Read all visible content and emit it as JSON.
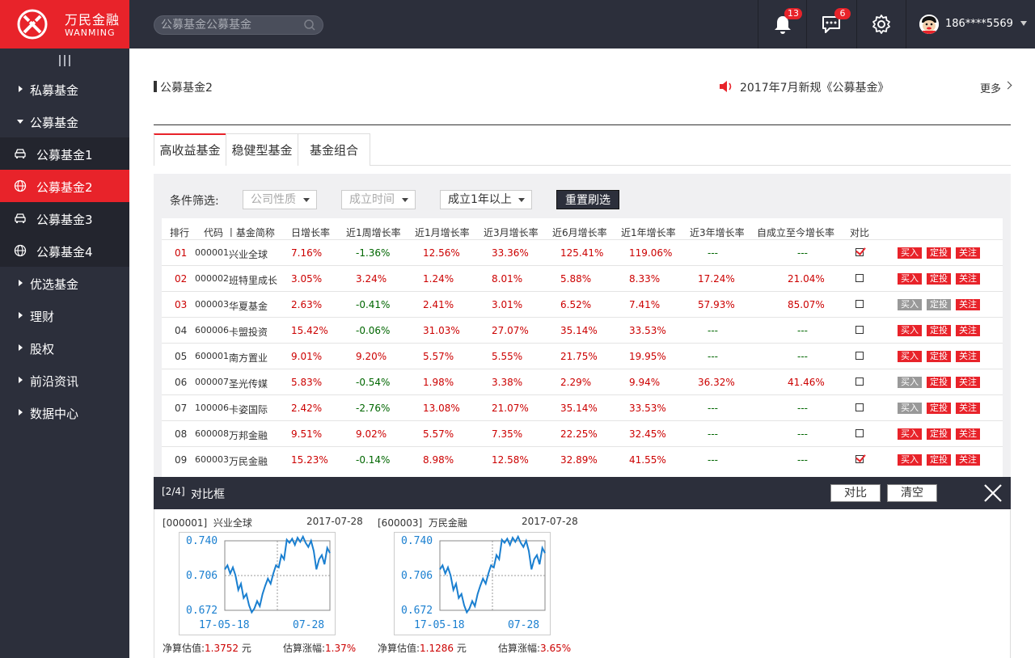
{
  "brand": {
    "name_cn": "万民金融",
    "name_en": "WANMING",
    "accent": "#e8232a",
    "dark": "#2c2f3b"
  },
  "header": {
    "search_placeholder": "公募基金公募基金",
    "notifications": {
      "icon": "bell-icon",
      "count": "13"
    },
    "messages": {
      "icon": "chat-icon",
      "count": "6"
    },
    "settings_icon": "gear-icon",
    "user": {
      "phone": "186****5569"
    }
  },
  "sidebar": {
    "items": [
      {
        "label": "私募基金",
        "expanded": false
      },
      {
        "label": "公募基金",
        "expanded": true
      }
    ],
    "sub_items": [
      {
        "label": "公募基金1",
        "icon": "car-icon",
        "active": false
      },
      {
        "label": "公募基金2",
        "icon": "globe-icon",
        "active": true
      },
      {
        "label": "公募基金3",
        "icon": "car-icon",
        "active": false
      },
      {
        "label": "公募基金4",
        "icon": "globe-icon",
        "active": false
      }
    ],
    "bottom_items": [
      {
        "label": "优选基金"
      },
      {
        "label": "理财"
      },
      {
        "label": "股权"
      },
      {
        "label": "前沿资讯"
      },
      {
        "label": "数据中心"
      }
    ]
  },
  "main": {
    "title": "公募基金2",
    "notice": "2017年7月新规《公募基金》",
    "more": "更多",
    "tabs": [
      {
        "label": "高收益基金",
        "active": true
      },
      {
        "label": "稳健型基金",
        "active": false
      },
      {
        "label": "基金组合",
        "active": false
      }
    ],
    "filter": {
      "label": "条件筛选:",
      "selects": [
        {
          "value": "公司性质",
          "placeholder": true
        },
        {
          "value": "成立时间",
          "placeholder": true
        },
        {
          "value": "成立1年以上",
          "placeholder": false
        }
      ],
      "reset": "重置刷选"
    },
    "table": {
      "headers": [
        "排行",
        "代码 丨基金简称",
        "日增长率",
        "近1周增长率",
        "近1月增长率",
        "近3月增长率",
        "近6月增长率",
        "近1年增长率",
        "近3年增长率",
        "自成立至今增长率",
        "对比"
      ],
      "action_labels": {
        "buy": "买入",
        "invest": "定投",
        "follow": "关注"
      },
      "rows": [
        {
          "rank": "01",
          "code": "000001",
          "name": "兴业全球",
          "d": "7.16%",
          "w": "-1.36%",
          "m1": "12.56%",
          "m3": "33.36%",
          "m6": "125.41%",
          "y1": "119.06%",
          "y3": "---",
          "all": "---",
          "checked": true,
          "buy_enabled": true,
          "invest_enabled": true,
          "top": true
        },
        {
          "rank": "02",
          "code": "000002",
          "name": "班特里成长",
          "d": "3.05%",
          "w": "3.24%",
          "m1": "1.24%",
          "m3": "8.01%",
          "m6": "5.88%",
          "y1": "8.33%",
          "y3": "17.24%",
          "all": "21.04%",
          "checked": false,
          "buy_enabled": true,
          "invest_enabled": true,
          "top": true
        },
        {
          "rank": "03",
          "code": "000003",
          "name": "华夏基金",
          "d": "2.63%",
          "w": "-0.41%",
          "m1": "2.41%",
          "m3": "3.01%",
          "m6": "6.52%",
          "y1": "7.41%",
          "y3": "57.93%",
          "all": "85.07%",
          "checked": false,
          "buy_enabled": false,
          "invest_enabled": false,
          "top": true
        },
        {
          "rank": "04",
          "code": "600006",
          "name": "卡盟投资",
          "d": "15.42%",
          "w": "-0.06%",
          "m1": "31.03%",
          "m3": "27.07%",
          "m6": "35.14%",
          "y1": "33.53%",
          "y3": "---",
          "all": "---",
          "checked": false,
          "buy_enabled": true,
          "invest_enabled": true,
          "top": false
        },
        {
          "rank": "05",
          "code": "600001",
          "name": "南方置业",
          "d": "9.01%",
          "w": "9.20%",
          "m1": "5.57%",
          "m3": "5.55%",
          "m6": "21.75%",
          "y1": "19.95%",
          "y3": "---",
          "all": "---",
          "checked": false,
          "buy_enabled": true,
          "invest_enabled": true,
          "top": false
        },
        {
          "rank": "06",
          "code": "000007",
          "name": "圣光传媒",
          "d": "5.83%",
          "w": "-0.54%",
          "m1": "1.98%",
          "m3": "3.38%",
          "m6": "2.29%",
          "y1": "9.94%",
          "y3": "36.32%",
          "all": "41.46%",
          "checked": false,
          "buy_enabled": false,
          "invest_enabled": true,
          "top": false
        },
        {
          "rank": "07",
          "code": "100006",
          "name": "卡姿国际",
          "d": "2.42%",
          "w": "-2.76%",
          "m1": "13.08%",
          "m3": "21.07%",
          "m6": "35.14%",
          "y1": "33.53%",
          "y3": "---",
          "all": "---",
          "checked": false,
          "buy_enabled": false,
          "invest_enabled": true,
          "top": false
        },
        {
          "rank": "08",
          "code": "600008",
          "name": "万邦金融",
          "d": "9.51%",
          "w": "9.02%",
          "m1": "5.57%",
          "m3": "7.35%",
          "m6": "22.25%",
          "y1": "32.45%",
          "y3": "---",
          "all": "---",
          "checked": false,
          "buy_enabled": true,
          "invest_enabled": true,
          "top": false
        },
        {
          "rank": "09",
          "code": "600003",
          "name": "万民金融",
          "d": "15.23%",
          "w": "-0.14%",
          "m1": "8.98%",
          "m3": "12.58%",
          "m6": "32.89%",
          "y1": "41.55%",
          "y3": "---",
          "all": "---",
          "checked": true,
          "buy_enabled": true,
          "invest_enabled": true,
          "top": false
        }
      ]
    }
  },
  "compare": {
    "count": "[2/4]",
    "title": "对比框",
    "compare_btn": "对比",
    "clear_btn": "清空",
    "close_icon": "close-icon",
    "nav_label": "净算估值:",
    "nav_unit": "元",
    "change_label": "估算涨幅:",
    "funds": [
      {
        "code": "[000001]",
        "name": "兴业全球",
        "date": "2017-07-28",
        "nav": "1.3752",
        "change": "1.37%",
        "chart": {
          "y_ticks": [
            "0.740",
            "0.706",
            "0.672"
          ],
          "x_ticks": [
            "17-05-18",
            "07-28"
          ],
          "values": [
            0.712,
            0.716,
            0.708,
            0.714,
            0.706,
            0.692,
            0.698,
            0.684,
            0.688,
            0.677,
            0.67,
            0.674,
            0.681,
            0.676,
            0.688,
            0.696,
            0.703,
            0.698,
            0.708,
            0.716,
            0.714,
            0.726,
            0.722,
            0.741,
            0.738,
            0.742,
            0.736,
            0.743,
            0.739,
            0.744,
            0.738,
            0.734,
            0.74,
            0.73,
            0.712,
            0.722,
            0.726,
            0.717,
            0.733,
            0.728
          ]
        }
      },
      {
        "code": "[600003]",
        "name": "万民金融",
        "date": "2017-07-28",
        "nav": "1.1286",
        "change": "3.65%",
        "chart": {
          "y_ticks": [
            "0.740",
            "0.706",
            "0.672"
          ],
          "x_ticks": [
            "17-05-18",
            "07-28"
          ],
          "values": [
            0.712,
            0.716,
            0.708,
            0.714,
            0.706,
            0.692,
            0.698,
            0.684,
            0.688,
            0.677,
            0.67,
            0.674,
            0.681,
            0.676,
            0.688,
            0.696,
            0.703,
            0.698,
            0.708,
            0.716,
            0.714,
            0.726,
            0.722,
            0.741,
            0.738,
            0.742,
            0.736,
            0.743,
            0.739,
            0.744,
            0.738,
            0.734,
            0.74,
            0.73,
            0.712,
            0.722,
            0.726,
            0.717,
            0.733,
            0.728
          ]
        }
      }
    ]
  }
}
